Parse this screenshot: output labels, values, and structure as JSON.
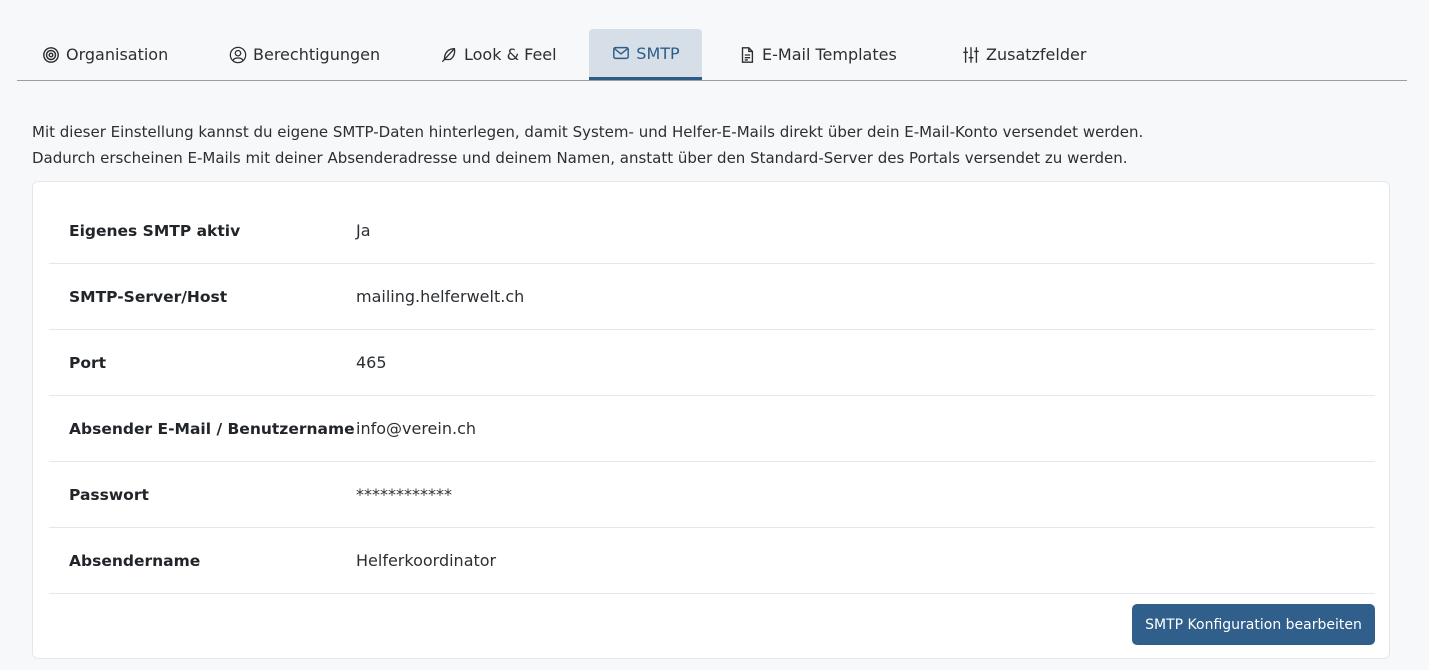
{
  "tabs": [
    {
      "label": "Organisation",
      "icon": "target-icon"
    },
    {
      "label": "Berechtigungen",
      "icon": "user-circle-icon"
    },
    {
      "label": "Look & Feel",
      "icon": "feather-icon"
    },
    {
      "label": "SMTP",
      "icon": "envelope-icon",
      "active": true
    },
    {
      "label": "E-Mail Templates",
      "icon": "file-text-icon"
    },
    {
      "label": "Zusatzfelder",
      "icon": "sliders-icon"
    }
  ],
  "intro": {
    "line1": "Mit dieser Einstellung kannst du eigene SMTP-Daten hinterlegen, damit System- und Helfer-E-Mails direkt über dein E-Mail-Konto versendet werden.",
    "line2": "Dadurch erscheinen E-Mails mit deiner Absenderadresse und deinem Namen, anstatt über den Standard-Server des Portals versendet zu werden."
  },
  "settings": [
    {
      "label": "Eigenes SMTP aktiv",
      "value": "Ja"
    },
    {
      "label": "SMTP-Server/Host",
      "value": "mailing.helferwelt.ch"
    },
    {
      "label": "Port",
      "value": "465"
    },
    {
      "label": "Absender E-Mail / Benutzername",
      "value": "info@verein.ch"
    },
    {
      "label": "Passwort",
      "value": "************"
    },
    {
      "label": "Absendername",
      "value": "Helferkoordinator"
    }
  ],
  "actions": {
    "edit_label": "SMTP Konfiguration bearbeiten"
  },
  "colors": {
    "accent": "#2f5f8a",
    "active_tab_bg": "#d6dee7",
    "page_bg": "#f7f8fa"
  }
}
